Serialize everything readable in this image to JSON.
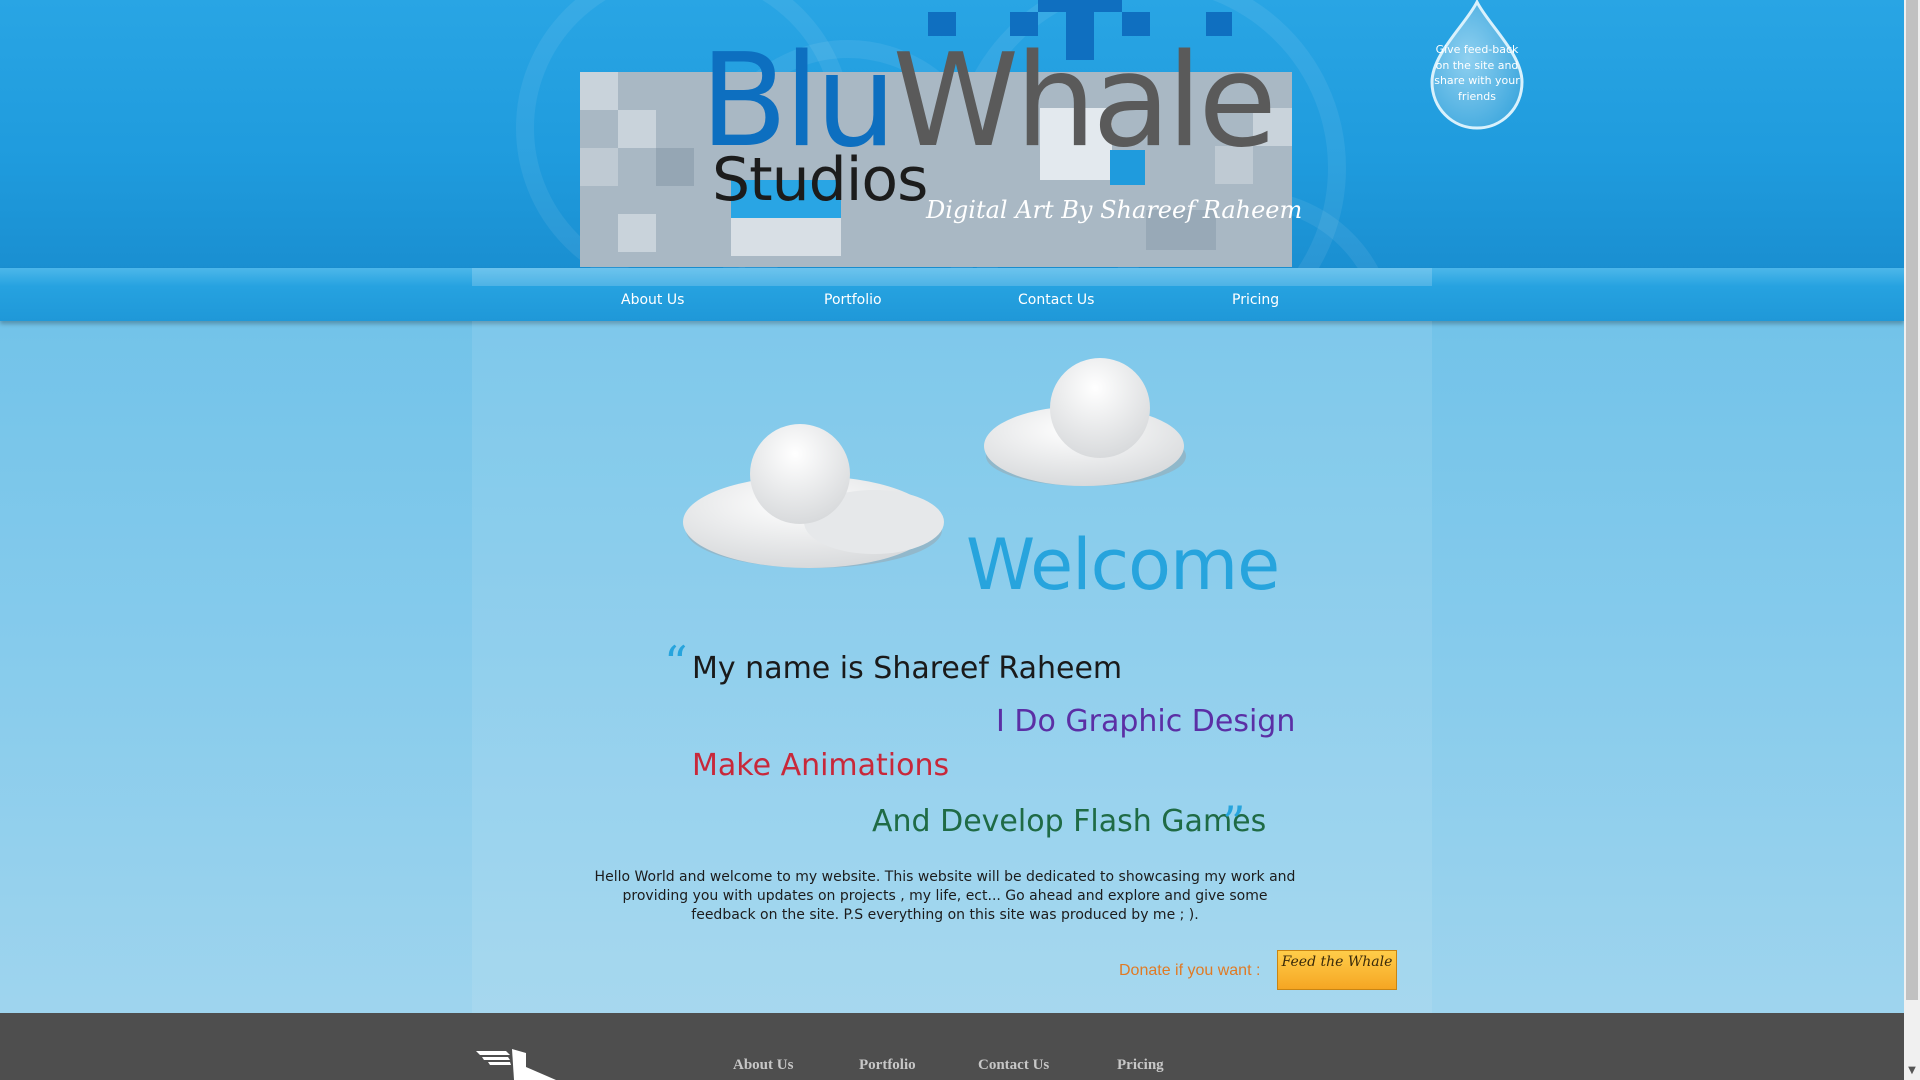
{
  "header": {
    "logo_blu": "Blu",
    "logo_whale": "Whale",
    "logo_studios": "Studios",
    "tagline": "Digital Art By Shareef Raheem",
    "feedback_text": "Give feed-back on the site and share with your friends"
  },
  "nav": {
    "items": [
      {
        "label": "About Us"
      },
      {
        "label": "Portfolio"
      },
      {
        "label": "Contact Us"
      },
      {
        "label": "Pricing"
      }
    ]
  },
  "main": {
    "welcome": "Welcome",
    "quote_open": "“",
    "quote_close": "”",
    "quote_lines": [
      "My name is Shareef Raheem",
      "I Do Graphic Design",
      "Make Animations",
      "And Develop Flash Games"
    ],
    "intro": "Hello World and welcome to my website. This website will be dedicated to showcasing my work and providing you with updates on projects , my life, ect...  Go ahead and explore and give some feedback on the site. P.S everything on this site was produced by me ; ).",
    "donate_label": "Donate if you want :",
    "donate_button": "Feed the Whale"
  },
  "footer": {
    "items": [
      {
        "label": "About Us"
      },
      {
        "label": "Portfolio"
      },
      {
        "label": "Contact Us"
      },
      {
        "label": "Pricing"
      }
    ]
  },
  "colors": {
    "accent": "#27a4dd",
    "header_blue": "#1f9bdd",
    "quote_purple": "#5b2fa5",
    "quote_red": "#c8283a",
    "quote_green": "#1f6b45",
    "donate_orange": "#e07a24",
    "footer_gray": "#4e4e4e"
  },
  "icons": [
    "feedback-drop-icon",
    "cloud-icon",
    "footer-logo-icon"
  ]
}
